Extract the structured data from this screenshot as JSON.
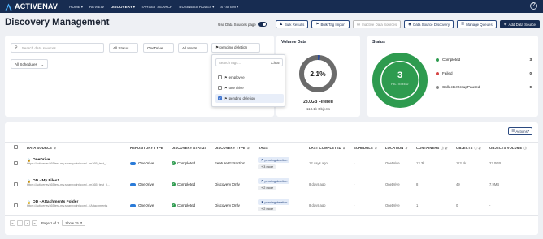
{
  "nav": {
    "logo": "ACTIVENAV",
    "items": [
      {
        "label": "HOME",
        "has_menu": true
      },
      {
        "label": "REVIEW",
        "has_menu": false
      },
      {
        "label": "DISCOVERY",
        "has_menu": true,
        "active": true
      },
      {
        "label": "TARGET SEARCH",
        "has_menu": false
      },
      {
        "label": "BUSINESS RULES",
        "has_menu": true
      },
      {
        "label": "SYSTEM",
        "has_menu": true
      }
    ],
    "caret": "▾",
    "help": "?"
  },
  "header": {
    "title": "Discovery Management",
    "toggle_label": "Use Data Sources page",
    "toggle_on": true,
    "buttons": {
      "bulk_results": "Bulk Results",
      "bulk_tag_import": "Bulk Tag Import",
      "inactive_sources": "Inactive Data Sources",
      "data_source_discovery": "Data Source Discovery",
      "manage_queues": "Manage Queues",
      "add_data_source": "Add Data Source"
    }
  },
  "filters": {
    "search_placeholder": "Search data sources...",
    "status": "All Status",
    "repository": "OneDrive",
    "hosts": "All Hosts",
    "tag": "pending deletion",
    "schedules": "All Schedules"
  },
  "tag_dropdown": {
    "search_placeholder": "Search tags...",
    "clear_label": "Clear",
    "options": [
      {
        "label": "employee",
        "checked": false
      },
      {
        "label": "one drive",
        "checked": false
      },
      {
        "label": "pending deletion",
        "checked": true
      }
    ]
  },
  "volume": {
    "title": "Volume Data",
    "percent_label": "2.1%",
    "percent": 2.1,
    "filtered_label": "23.0GB Filtered",
    "objects_label": "113.1k Objects",
    "colors": {
      "track": "#6b6b6b",
      "fill": "#2b4a9a"
    }
  },
  "status": {
    "title": "Status",
    "total": "3",
    "total_caption": "FILTERED",
    "items": [
      {
        "label": "Completed",
        "count": "3",
        "color": "#2e9b4f"
      },
      {
        "label": "Failed",
        "count": "0",
        "color": "#d64545"
      },
      {
        "label": "CollectorGroupPaused",
        "count": "0",
        "color": "#888888"
      }
    ]
  },
  "table": {
    "actions_label": "Actions",
    "columns": {
      "data_source": "DATA SOURCE",
      "repository_type": "REPOSITORY TYPE",
      "discovery_status": "DISCOVERY STATUS",
      "discovery_type": "DISCOVERY TYPE",
      "tags": "TAGS",
      "last_completed": "LAST COMPLETED",
      "schedule": "SCHEDULE",
      "location": "LOCATION",
      "containers": "CONTAINERS",
      "objects": "OBJECTS",
      "objects_volume": "OBJECTS VOLUME"
    },
    "rows": [
      {
        "name": "OneDrive",
        "url": "https://activenav365test-my.sharepoint.com/...m365_test_f...",
        "repository": "OneDrive",
        "status": "Completed",
        "discovery_type": "Feature Extraction",
        "tag": "pending deletion",
        "more": "+ 3 more",
        "last_completed": "12 days ago",
        "schedule": "-",
        "location": "OneDrive",
        "containers": "13.3k",
        "objects": "113.1k",
        "volume": "23.0GB"
      },
      {
        "name": "OD - My Files1",
        "url": "https://activenav365test-my.sharepoint.com/...m365_test_fi...",
        "repository": "OneDrive",
        "status": "Completed",
        "discovery_type": "Discovery Only",
        "tag": "pending deletion",
        "more": "+ 2 more",
        "last_completed": "8 days ago",
        "schedule": "-",
        "location": "OneDrive",
        "containers": "8",
        "objects": "49",
        "volume": "7.9MB"
      },
      {
        "name": "OD - Attachments Folder",
        "url": "https://activenav365test-my.sharepoint.com/.../Attachments",
        "repository": "OneDrive",
        "status": "Completed",
        "discovery_type": "Discovery Only",
        "tag": "pending deletion",
        "more": "+ 2 more",
        "last_completed": "8 days ago",
        "schedule": "-",
        "location": "OneDrive",
        "containers": "1",
        "objects": "0",
        "volume": "-"
      }
    ]
  },
  "pagination": {
    "page_info": "Page 1 of 1",
    "page_size": "Show 25"
  }
}
